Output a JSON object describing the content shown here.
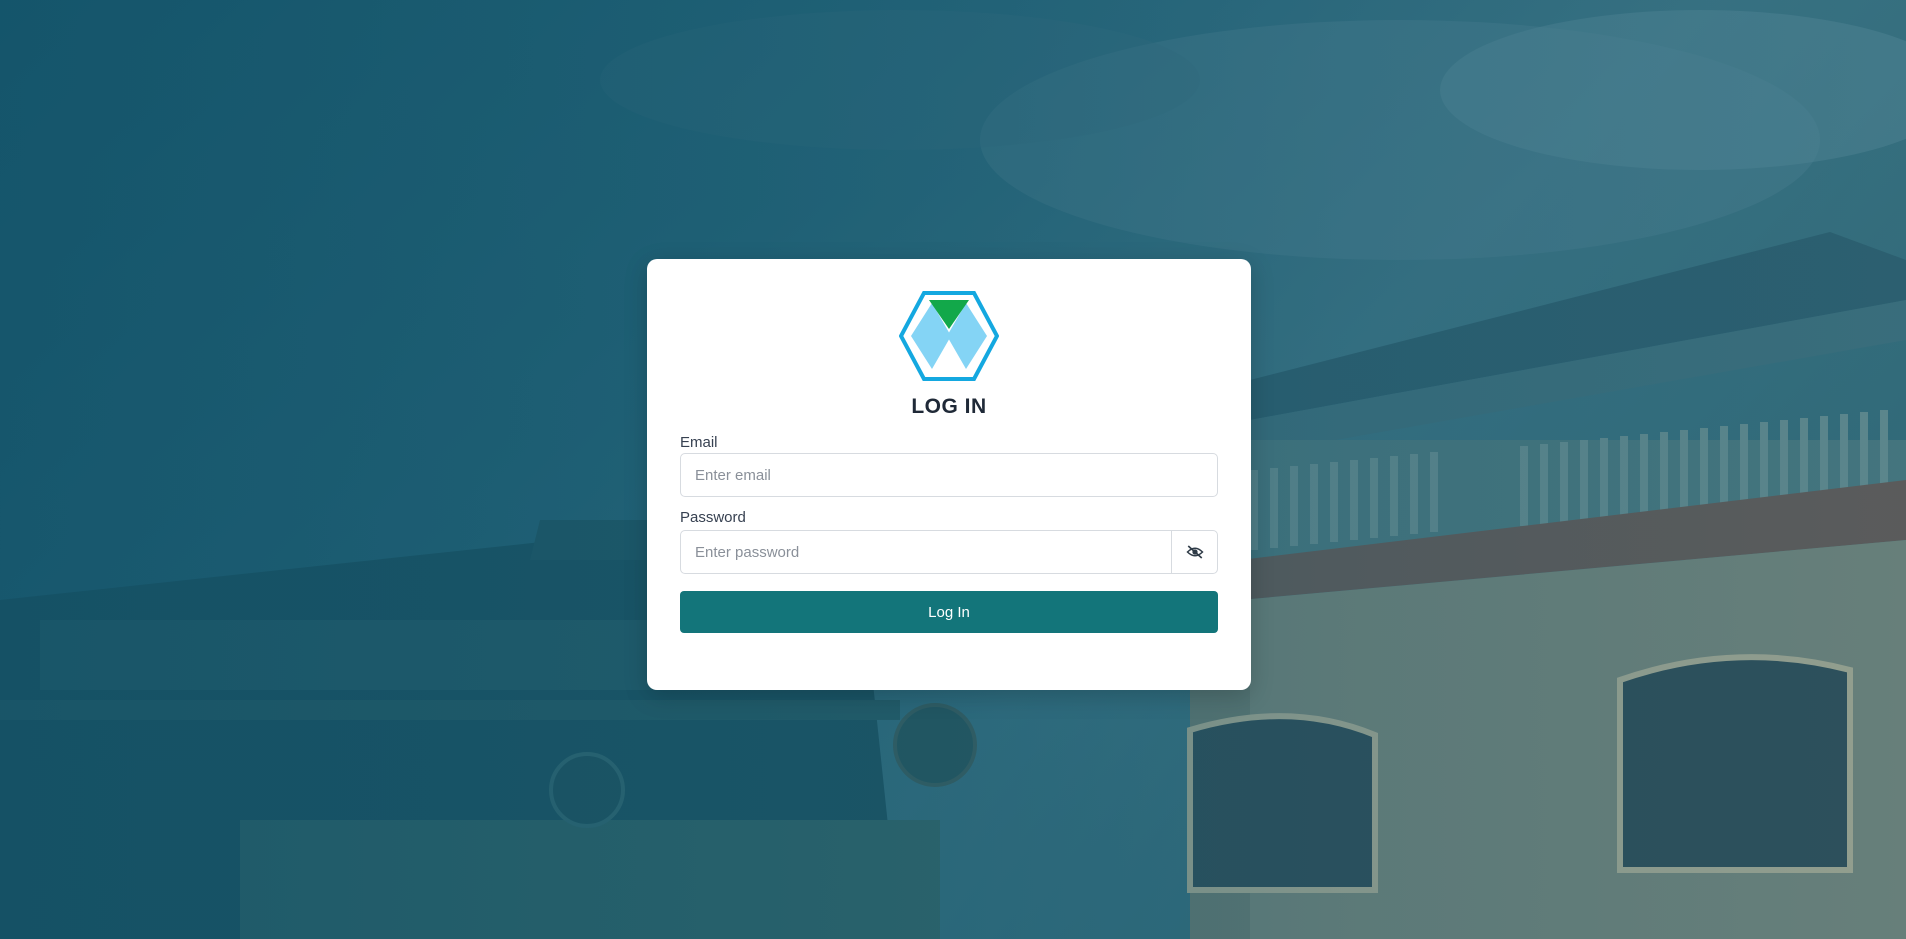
{
  "login": {
    "title": "LOG IN",
    "email_label": "Email",
    "email_placeholder": "Enter email",
    "email_value": "",
    "password_label": "Password",
    "password_placeholder": "Enter password",
    "password_value": "",
    "toggle_icon": "eye-slash-icon",
    "submit_label": "Log In"
  },
  "brand": {
    "logo_icon": "hexagon-logo-icon",
    "colors": {
      "hex_outline": "#14a8e0",
      "hex_fill": "#84d4f5",
      "triangle": "#12a84a",
      "button": "#13757a"
    }
  }
}
